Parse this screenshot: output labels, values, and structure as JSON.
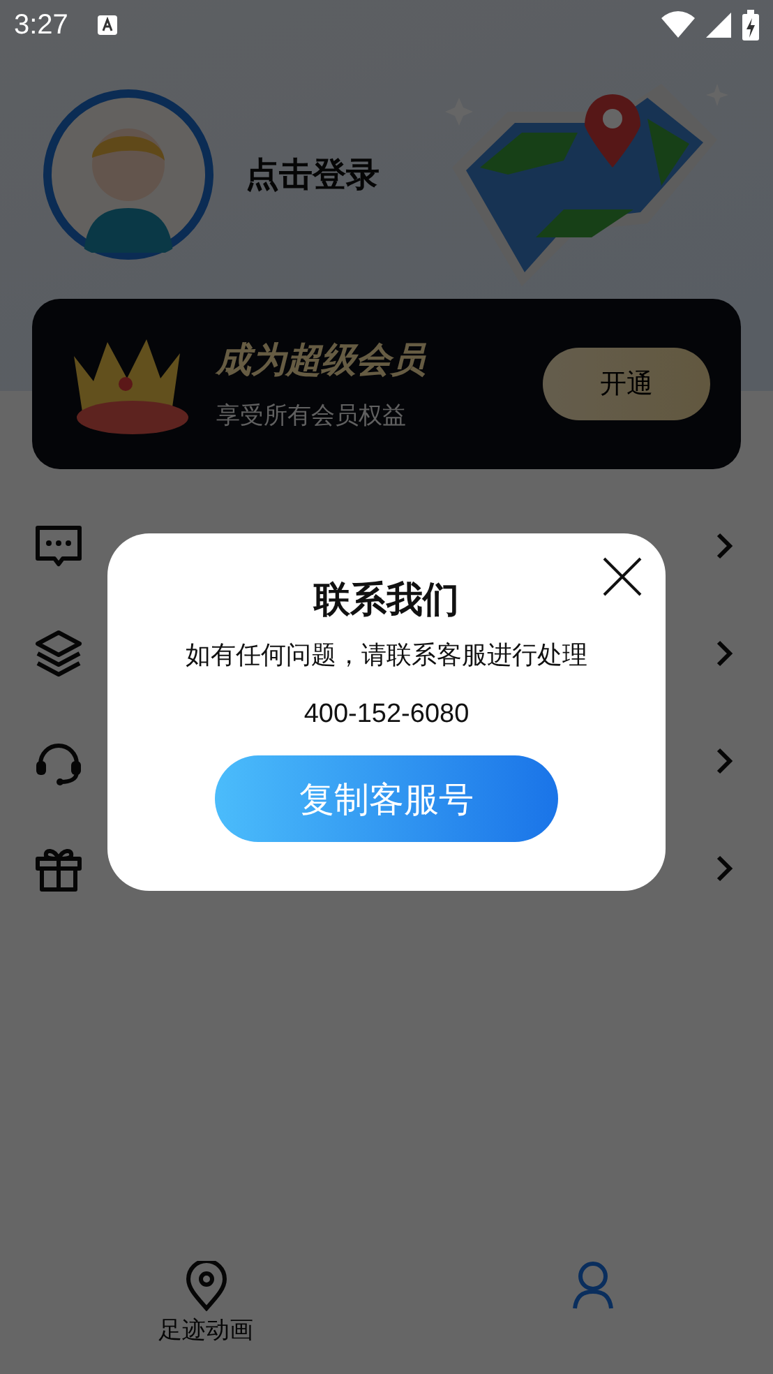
{
  "status_bar": {
    "time": "3:27"
  },
  "profile": {
    "login_label": "点击登录"
  },
  "vip_card": {
    "title": "成为超级会员",
    "subtitle": "享受所有会员权益",
    "button": "开通"
  },
  "bottom_nav": [
    {
      "label": "足迹动画",
      "selected": false
    },
    {
      "selected": true
    }
  ],
  "dialog": {
    "title": "联系我们",
    "message": "如有任何问题，请联系客服进行处理",
    "phone": "400-152-6080",
    "button": "复制客服号"
  }
}
